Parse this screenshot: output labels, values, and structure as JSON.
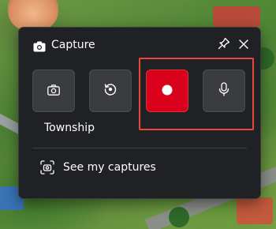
{
  "capture_widget": {
    "title": "Capture",
    "title_icon": "camera-icon",
    "pin_icon": "pin-icon",
    "close_icon": "close-icon",
    "buttons": [
      {
        "name": "screenshot-button",
        "icon": "camera-icon"
      },
      {
        "name": "record-last-30-seconds-button",
        "icon": "replay-icon"
      },
      {
        "name": "start-recording-button",
        "icon": "record-dot-icon",
        "color": "#d9001b"
      },
      {
        "name": "microphone-button",
        "icon": "microphone-icon"
      }
    ],
    "highlight_color": "#e8473b",
    "game_name": "Township",
    "see_captures_label": "See my captures",
    "see_captures_icon": "gallery-icon"
  }
}
